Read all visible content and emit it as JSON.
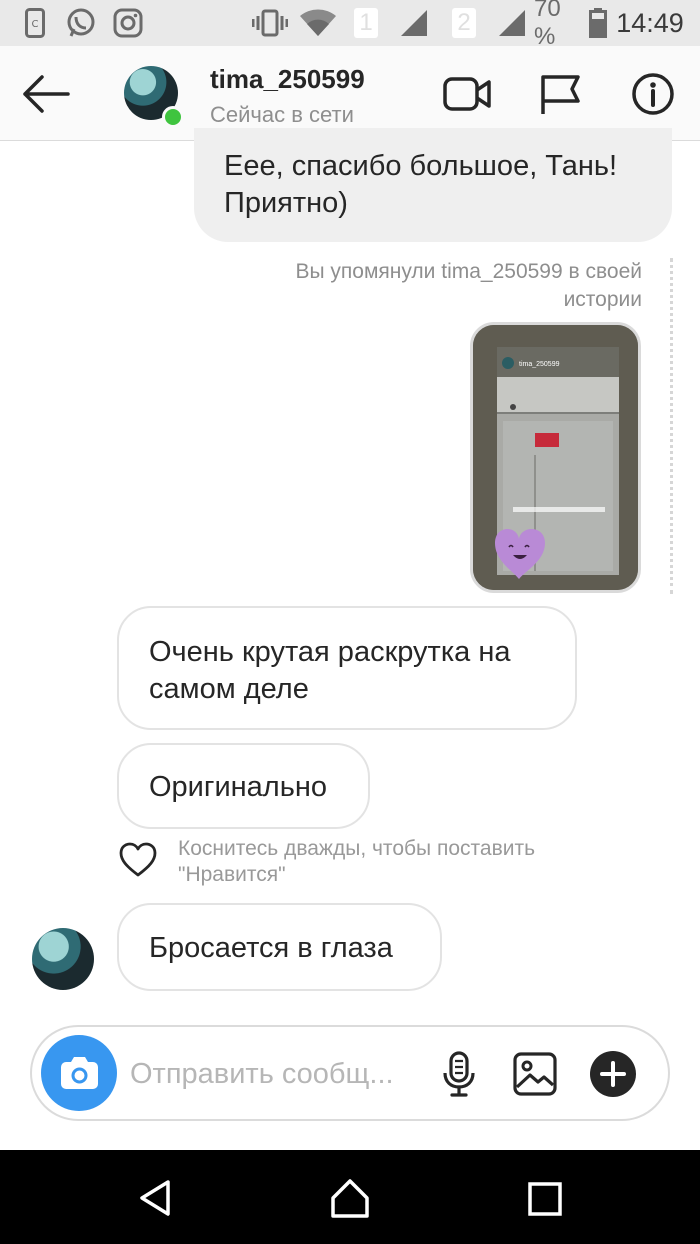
{
  "status_bar": {
    "sim1": "1",
    "sim2": "2",
    "battery": "70 %",
    "time": "14:49"
  },
  "header": {
    "username": "tima_250599",
    "status": "Сейчас в сети"
  },
  "messages": [
    {
      "sender": "me",
      "text": "Еее, спасибо большое, Тань! Приятно)"
    },
    {
      "sender": "me",
      "type": "story_mention",
      "caption": "Вы упомянули tima_250599 в своей истории",
      "story_username": "tima_250599"
    },
    {
      "sender": "them",
      "text": "Очень крутая раскрутка на самом деле"
    },
    {
      "sender": "them",
      "text": "Оригинально"
    },
    {
      "sender": "them",
      "text": "Бросается в глаза"
    }
  ],
  "like_hint": "Коснитесь дважды, чтобы поставить \"Нравится\"",
  "composer": {
    "placeholder": "Отправить сообщ..."
  },
  "colors": {
    "accent": "#3897f0",
    "online": "#3fc43f",
    "story_heart": "#b98ad6"
  }
}
